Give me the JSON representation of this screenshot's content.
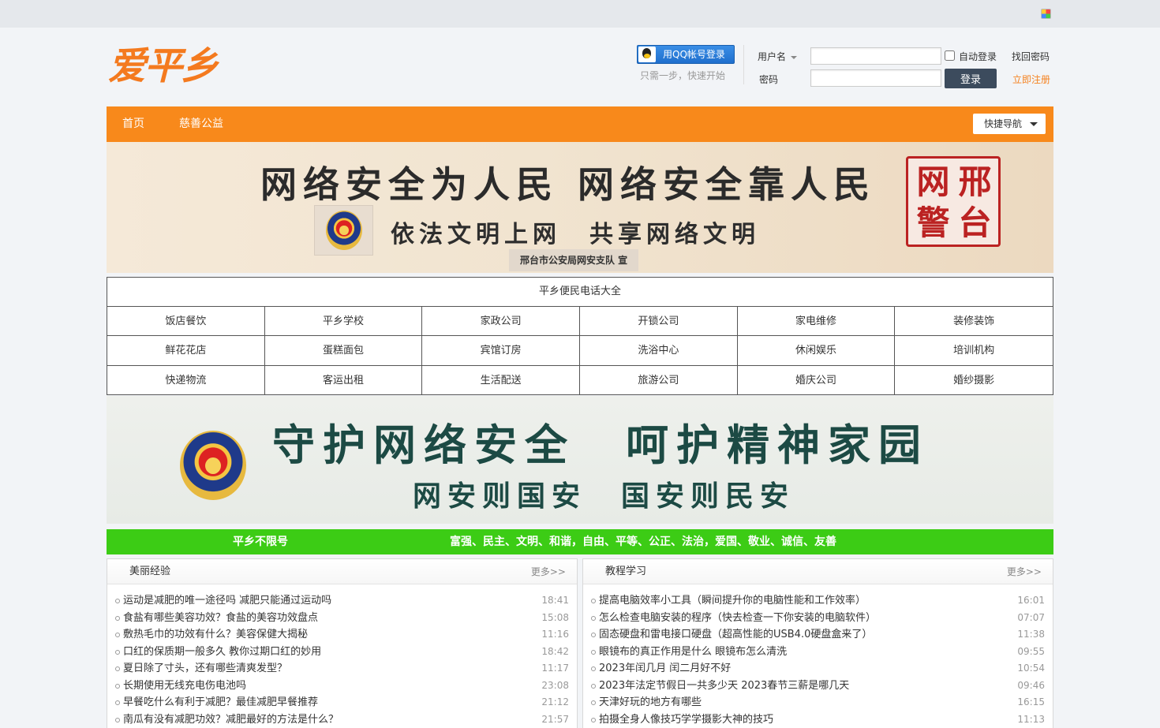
{
  "header": {
    "logo_text": "爱平乡",
    "qq_login": "用QQ帐号登录",
    "qq_tagline": "只需一步，快速开始",
    "username_label": "用户名",
    "password_label": "密码",
    "auto_login": "自动登录",
    "find_password": "找回密码",
    "login_button": "登录",
    "register": "立即注册"
  },
  "nav": {
    "items": [
      "首页",
      "慈善公益"
    ],
    "quick_nav": "快捷导航"
  },
  "banner1": {
    "line1": "网络安全为人民 网络安全靠人民",
    "line2": "依法文明上网　共享网络文明",
    "sub": "邢台市公安局网安支队 宣",
    "seal": [
      "网",
      "邢",
      "警",
      "台"
    ]
  },
  "phone_directory": {
    "title": "平乡便民电话大全",
    "cells": [
      "饭店餐饮",
      "平乡学校",
      "家政公司",
      "开锁公司",
      "家电维修",
      "装修装饰",
      "鲜花花店",
      "蛋糕面包",
      "宾馆订房",
      "洗浴中心",
      "休闲娱乐",
      "培训机构",
      "快递物流",
      "客运出租",
      "生活配送",
      "旅游公司",
      "婚庆公司",
      "婚纱摄影"
    ]
  },
  "banner2": {
    "line1": "守护网络安全　呵护精神家园",
    "line2": "网安则国安　国安则民安"
  },
  "greenbar": {
    "left": "平乡不限号",
    "right": "富强、民主、文明、和谐，自由、平等、公正、法治，爱国、敬业、诚信、友善"
  },
  "panels": [
    {
      "title": "美丽经验",
      "more": "更多>>",
      "items": [
        {
          "text": "运动是减肥的唯一途径吗 减肥只能通过运动吗",
          "time": "18:41"
        },
        {
          "text": "食盐有哪些美容功效？食盐的美容功效盘点",
          "time": "15:08"
        },
        {
          "text": "敷热毛巾的功效有什么？美容保健大揭秘",
          "time": "11:16"
        },
        {
          "text": "口红的保质期一般多久 教你过期口红的妙用",
          "time": "18:42"
        },
        {
          "text": "夏日除了寸头，还有哪些清爽发型？",
          "time": "11:17"
        },
        {
          "text": "长期使用无线充电伤电池吗",
          "time": "23:08"
        },
        {
          "text": "早餐吃什么有利于减肥？最佳减肥早餐推荐",
          "time": "21:12"
        },
        {
          "text": "南瓜有没有减肥功效？减肥最好的方法是什么？",
          "time": "21:57"
        }
      ]
    },
    {
      "title": "教程学习",
      "more": "更多>>",
      "items": [
        {
          "text": "提高电脑效率小工具（瞬间提升你的电脑性能和工作效率）",
          "time": "16:01"
        },
        {
          "text": "怎么检查电脑安装的程序（快去检查一下你安装的电脑软件）",
          "time": "07:07"
        },
        {
          "text": "固态硬盘和雷电接口硬盘（超高性能的USB4.0硬盘盒来了）",
          "time": "11:38"
        },
        {
          "text": "眼镜布的真正作用是什么 眼镜布怎么清洗",
          "time": "09:55"
        },
        {
          "text": "2023年闰几月 闰二月好不好",
          "time": "10:54"
        },
        {
          "text": "2023年法定节假日一共多少天 2023春节三薪是哪几天",
          "time": "09:46"
        },
        {
          "text": "天津好玩的地方有哪些",
          "time": "16:15"
        },
        {
          "text": "拍摄全身人像技巧学学摄影大神的技巧",
          "time": "11:13"
        }
      ]
    }
  ]
}
